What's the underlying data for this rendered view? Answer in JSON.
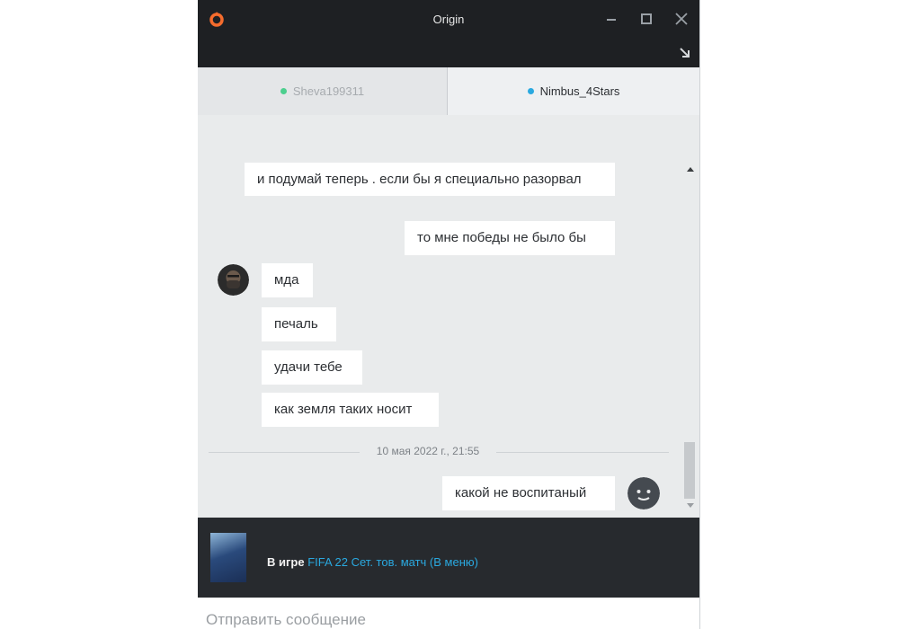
{
  "window": {
    "title": "Origin"
  },
  "colors": {
    "accent": "#f56c2d",
    "online_green": "#4ccf8e",
    "online_blue": "#2aa9e0",
    "titlebar": "#1e2023"
  },
  "icons": {
    "logo": "origin-logo-icon",
    "minimize": "minimize-icon",
    "maximize": "maximize-icon",
    "close": "close-icon",
    "popout": "popout-arrow-icon"
  },
  "tabs": [
    {
      "name": "Sheva199311",
      "active": false
    },
    {
      "name": "Nimbus_4Stars",
      "active": true
    }
  ],
  "messages": [
    {
      "text": "и подумай теперь . если бы я специально разорвал",
      "side": "right"
    },
    {
      "text": "то мне победы не было бы",
      "side": "right"
    },
    {
      "text": "мда",
      "side": "left"
    },
    {
      "text": "печаль",
      "side": "left"
    },
    {
      "text": "удачи тебе",
      "side": "left"
    },
    {
      "text": "как земля таких носит",
      "side": "left"
    },
    {
      "text": "какой не воспитаный",
      "side": "right"
    }
  ],
  "separator": {
    "timestamp": "10 мая 2022 г., 21:55"
  },
  "status": {
    "label": "В игре",
    "game": "FIFA 22 Сет. тов. матч (В меню)"
  },
  "input": {
    "placeholder": "Отправить сообщение",
    "value": ""
  }
}
